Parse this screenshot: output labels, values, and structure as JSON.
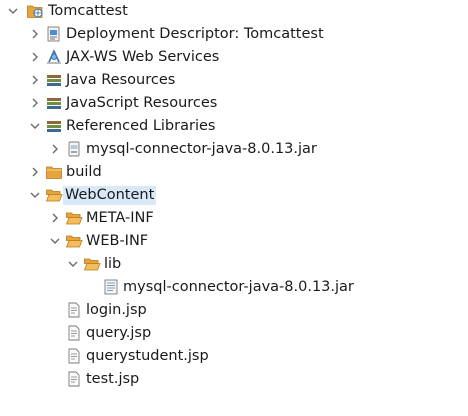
{
  "tree": {
    "project": {
      "label": "Tomcattest"
    },
    "deployment_descriptor": {
      "label": "Deployment Descriptor: Tomcattest"
    },
    "jaxws": {
      "label": "JAX-WS Web Services"
    },
    "java_resources": {
      "label": "Java Resources"
    },
    "javascript_resources": {
      "label": "JavaScript Resources"
    },
    "referenced_libraries": {
      "label": "Referenced Libraries"
    },
    "ref_jar": {
      "label": "mysql-connector-java-8.0.13.jar"
    },
    "build": {
      "label": "build"
    },
    "webcontent": {
      "label": "WebContent"
    },
    "meta_inf": {
      "label": "META-INF"
    },
    "web_inf": {
      "label": "WEB-INF"
    },
    "lib": {
      "label": "lib"
    },
    "lib_jar": {
      "label": "mysql-connector-java-8.0.13.jar"
    },
    "files": [
      {
        "label": "login.jsp"
      },
      {
        "label": "query.jsp"
      },
      {
        "label": "querystudent.jsp"
      },
      {
        "label": "test.jsp"
      }
    ]
  },
  "colors": {
    "selection": "#d9e9f7",
    "folder": "#e8a43c",
    "chevron": "#6b6b6b"
  }
}
